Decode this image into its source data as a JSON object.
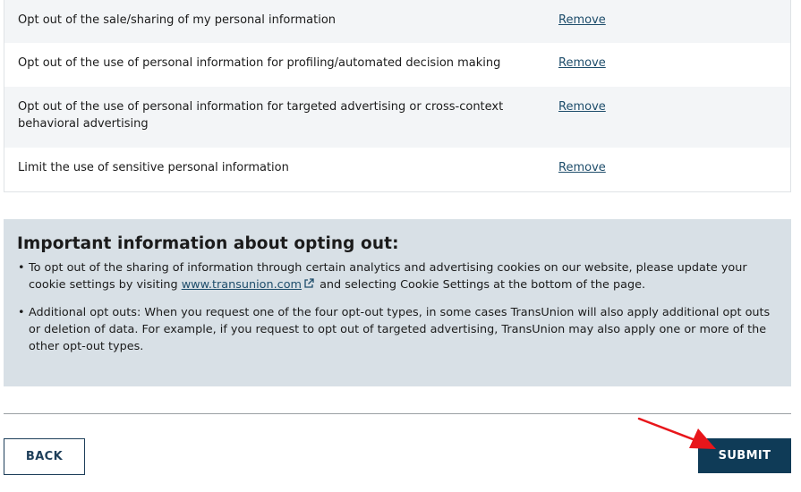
{
  "opt_list": {
    "items": [
      {
        "label": "Opt out of the sale/sharing of my personal information",
        "action": "Remove"
      },
      {
        "label": "Opt out of the use of personal information for profiling/automated decision making",
        "action": "Remove"
      },
      {
        "label": "Opt out of the use of personal information for targeted advertising or cross-context behavioral advertising",
        "action": "Remove"
      },
      {
        "label": "Limit the use of sensitive personal information",
        "action": "Remove"
      }
    ]
  },
  "info": {
    "title": "Important information about opting out:",
    "bullet1_before": "To opt out of the sharing of information through certain analytics and advertising cookies on our website, please update your cookie settings by visiting ",
    "bullet1_link": "www.transunion.com",
    "bullet1_after": " and selecting Cookie Settings at the bottom of the page.",
    "bullet2": "Additional opt outs: When you request one of the four opt-out types, in some cases TransUnion will also apply additional opt outs or deletion of data. For example, if you request to opt out of targeted advertising, TransUnion may also apply one or more of the other opt-out types.",
    "bullet_char": "•"
  },
  "actions": {
    "back_label": "BACK",
    "submit_label": "SUBMIT"
  },
  "colors": {
    "accent": "#0f3b57",
    "link": "#1e4d6b",
    "info_bg": "#d8e0e6",
    "annotation_arrow": "#e8161b"
  },
  "icons": {
    "external_link": "external-link-icon",
    "annotation": "red-arrow-icon"
  }
}
